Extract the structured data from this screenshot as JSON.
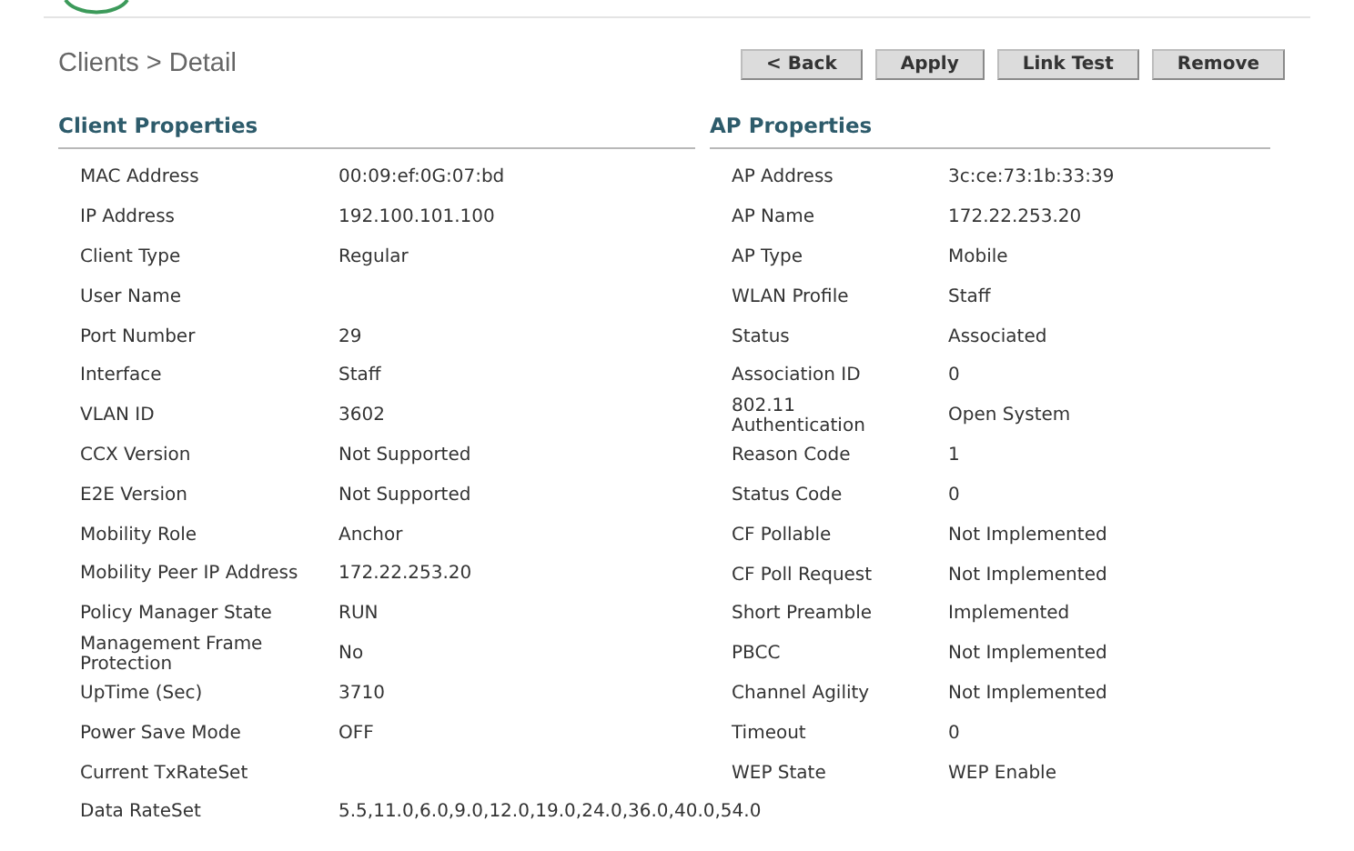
{
  "page_title": "Clients > Detail",
  "buttons": [
    "< Back",
    "Apply",
    "Link Test",
    "Remove"
  ],
  "client_properties": {
    "heading": "Client Properties",
    "rows": [
      {
        "label": "MAC Address",
        "value": "00:09:ef:0G:07:bd"
      },
      {
        "label": "IP Address",
        "value": "192.100.101.100"
      },
      {
        "label": "Client Type",
        "value": "Regular"
      },
      {
        "label": "User Name"
      },
      {
        "label": "Port Number",
        "value": "29"
      },
      {
        "label": "Interface",
        "value": "Staff"
      },
      {
        "label": "VLAN ID",
        "value": "3602"
      },
      {
        "label": "CCX Version",
        "value": "Not Supported"
      },
      {
        "label": "E2E Version",
        "value": "Not Supported"
      },
      {
        "label": "Mobility Role",
        "value": "Anchor"
      },
      {
        "label": "Mobility Peer IP Address",
        "value": "172.22.253.20"
      },
      {
        "label": "Policy Manager State",
        "value": "RUN"
      },
      {
        "label": "Management Frame Protection",
        "value": "No"
      },
      {
        "label": "UpTime (Sec)",
        "value": "3710"
      },
      {
        "label": "Power Save Mode",
        "value": "OFF"
      },
      {
        "label": "Current TxRateSet"
      },
      {
        "label": "Data RateSet",
        "value": "5.5,11.0,6.0,9.0,12.0,19.0,24.0,36.0,40.0,54.0"
      }
    ]
  },
  "ap_properties": {
    "heading": "AP Properties",
    "rows": [
      {
        "label": "AP Address",
        "value": "3c:ce:73:1b:33:39"
      },
      {
        "label": "AP Name",
        "value": "172.22.253.20"
      },
      {
        "label": "AP Type",
        "value": "Mobile"
      },
      {
        "label": "WLAN Profile",
        "value": "Staff"
      },
      {
        "label": "Status",
        "value": "Associated"
      },
      {
        "label": "Association ID",
        "value": "0"
      },
      {
        "label": "802.11 Authentication",
        "value": "Open System"
      },
      {
        "label": "Reason Code",
        "value": "1"
      },
      {
        "label": "Status Code",
        "value": "0"
      },
      {
        "label": "CF Pollable",
        "value": "Not Implemented"
      },
      {
        "label": "CF Poll Request",
        "value": "Not Implemented"
      },
      {
        "label": "Short Preamble",
        "value": "Implemented"
      },
      {
        "label": "PBCC",
        "value": "Not Implemented"
      },
      {
        "label": "Channel Agility",
        "value": "Not Implemented"
      },
      {
        "label": "Timeout",
        "value": "0"
      },
      {
        "label": "WEP State",
        "value": "WEP Enable"
      }
    ]
  }
}
